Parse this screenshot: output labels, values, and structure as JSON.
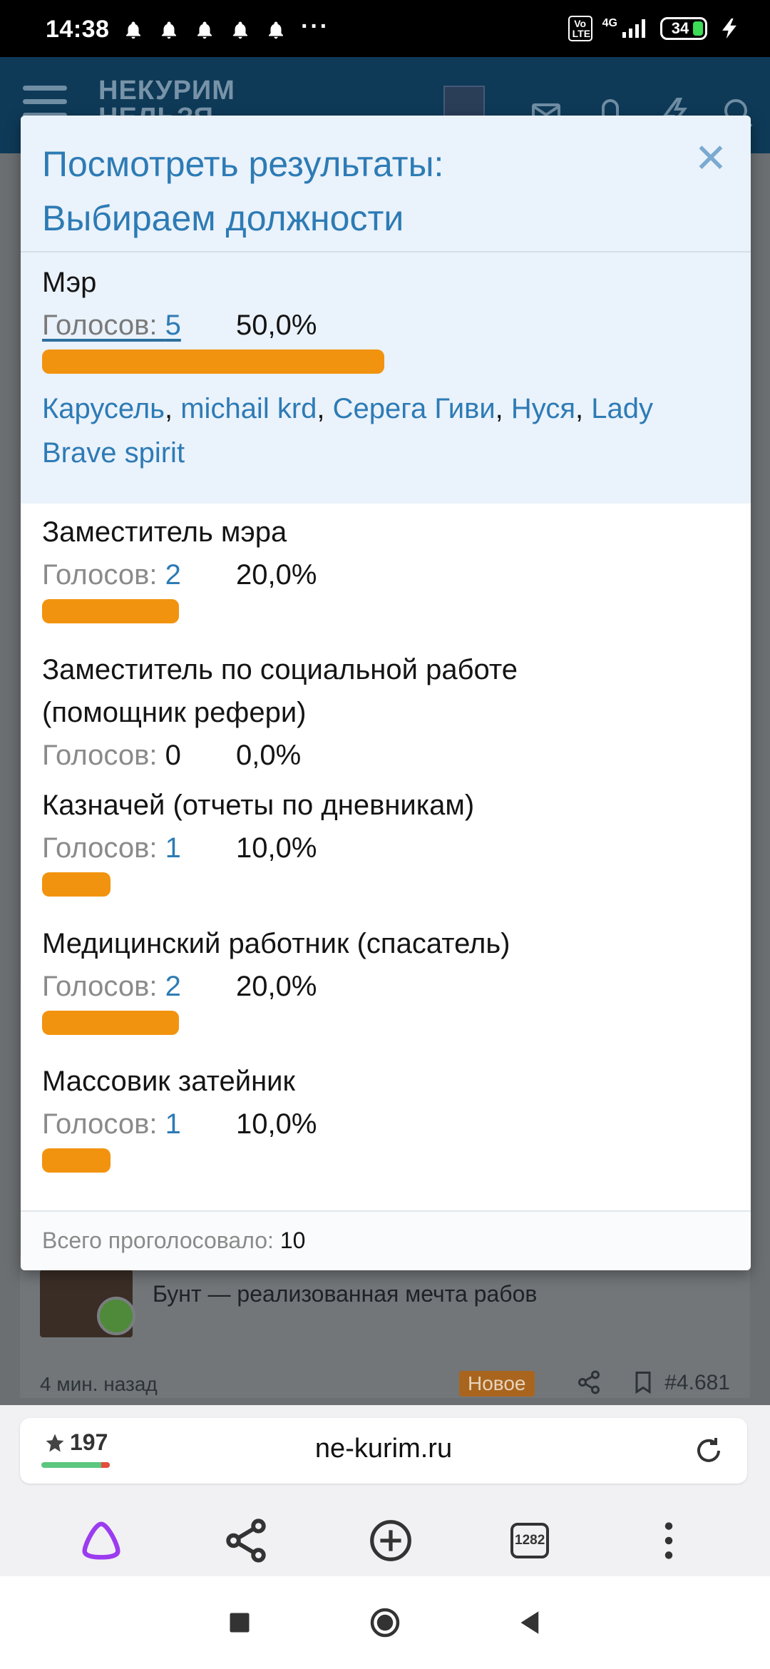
{
  "status_bar": {
    "time": "14:38",
    "more": "···",
    "volte": "Vo LTE",
    "network": "4G",
    "battery": "34"
  },
  "site_header": {
    "logo_line1": "НЕКУРИМ",
    "logo_line2": "НЕЛЬЗЯ"
  },
  "poll": {
    "title_line1": "Посмотреть результаты:",
    "title_line2": "Выбираем должности",
    "votes_label": "Голосов:",
    "options": [
      {
        "label": "Мэр",
        "votes": "5",
        "percent": "50,0%",
        "fraction": 0.5
      },
      {
        "label": "Заместитель мэра",
        "votes": "2",
        "percent": "20,0%",
        "fraction": 0.2
      },
      {
        "label": "Заместитель по социальной работе (помощник рефери)",
        "votes": "0",
        "percent": "0,0%",
        "fraction": 0
      },
      {
        "label": "Казначей (отчеты по дневникам)",
        "votes": "1",
        "percent": "10,0%",
        "fraction": 0.1
      },
      {
        "label": "Медицинский работник (спасатель)",
        "votes": "2",
        "percent": "20,0%",
        "fraction": 0.2
      },
      {
        "label": "Массовик затейник",
        "votes": "1",
        "percent": "10,0%",
        "fraction": 0.1
      }
    ],
    "voters": [
      "Карусель",
      "michail krd",
      "Серега Гиви",
      "Нуся",
      "Lady Brave spirit"
    ],
    "total_label": "Всего проголосовало:",
    "total_value": "10"
  },
  "background_post": {
    "quote": "Бунт — реализованная мечта рабов",
    "time_ago": "4 мин. назад",
    "new_badge": "Новое",
    "post_number": "#4.681"
  },
  "browser": {
    "rating": "197",
    "url": "ne-kurim.ru",
    "tab_count": "1282"
  },
  "colors": {
    "accent_blue": "#2d7bb5",
    "bar_orange": "#f2930f",
    "highlight_bg": "#eaf2fb"
  }
}
